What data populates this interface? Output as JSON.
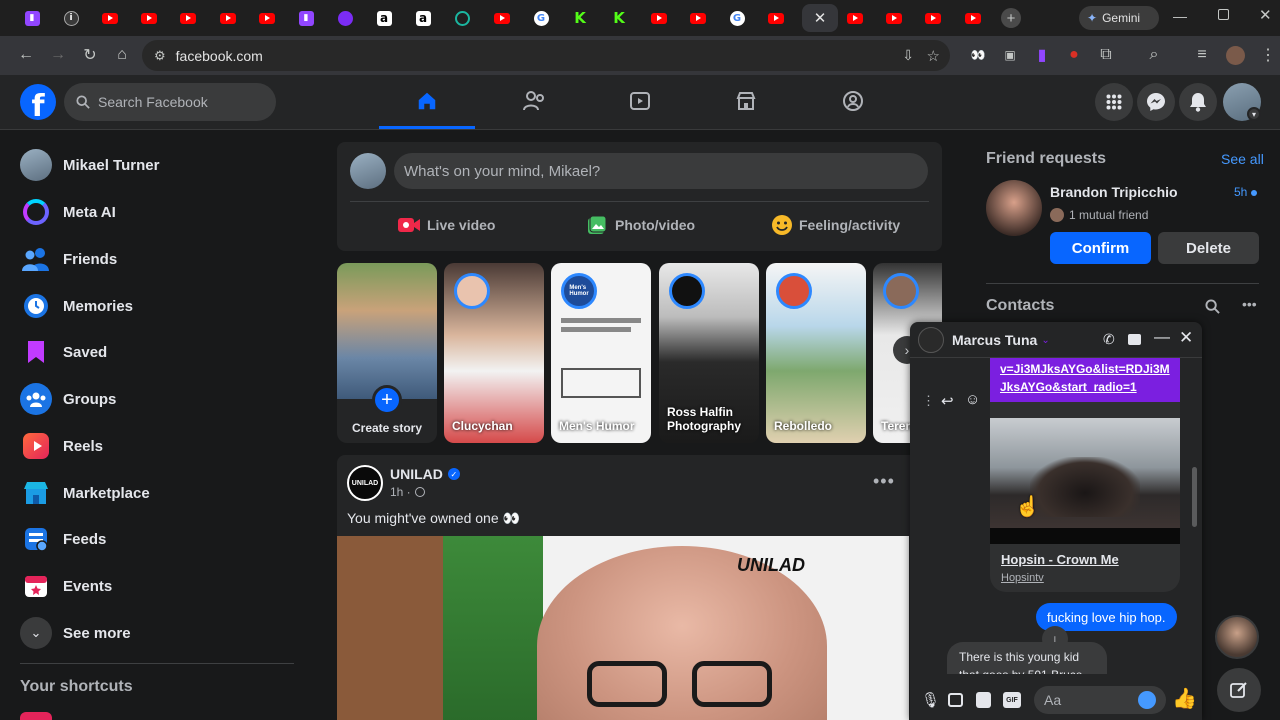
{
  "browser": {
    "gemini_label": "Gemini",
    "url": "facebook.com"
  },
  "fb": {
    "search_placeholder": "Search Facebook",
    "profile_name": "Mikael Turner",
    "sidebar": [
      {
        "label": "Mikael Turner",
        "icon": "avatar"
      },
      {
        "label": "Meta AI",
        "icon": "meta-ai-icon"
      },
      {
        "label": "Friends",
        "icon": "friends-icon"
      },
      {
        "label": "Memories",
        "icon": "memories-icon"
      },
      {
        "label": "Saved",
        "icon": "saved-icon"
      },
      {
        "label": "Groups",
        "icon": "groups-icon"
      },
      {
        "label": "Reels",
        "icon": "reels-icon"
      },
      {
        "label": "Marketplace",
        "icon": "marketplace-icon"
      },
      {
        "label": "Feeds",
        "icon": "feeds-icon"
      },
      {
        "label": "Events",
        "icon": "events-icon"
      },
      {
        "label": "See more",
        "icon": "chevron-down-icon"
      }
    ],
    "shortcuts_heading": "Your shortcuts",
    "composer": {
      "placeholder": "What's on your mind, Mikael?",
      "live": "Live video",
      "photo": "Photo/video",
      "feeling": "Feeling/activity"
    },
    "stories": [
      {
        "name": "Create story"
      },
      {
        "name": "Clucychan"
      },
      {
        "name": "Men's Humor"
      },
      {
        "name": "Ross Halfin Photography"
      },
      {
        "name": "Rebolledo"
      },
      {
        "name": "Teren"
      }
    ],
    "post": {
      "page": "UNILAD",
      "time": "1h ·",
      "text": "You might've owned one 👀",
      "watermark": "UNILAD"
    },
    "friend_requests": {
      "heading": "Friend requests",
      "see_all": "See all",
      "name": "Brandon Tripicchio",
      "time": "5h",
      "mutual": "1 mutual friend",
      "confirm": "Confirm",
      "delete": "Delete"
    },
    "contacts_heading": "Contacts",
    "chat": {
      "name": "Marcus Tuna",
      "link_text": "v=Ji3MJksAYGo&list=RDJi3MJksAYGo&start_radio=1",
      "video_title": "Hopsin - Crown Me",
      "video_channel": "Hopsintv",
      "sent_message": "fucking love hip hop.",
      "received_message": "There is this young kid that goes by 501 Bruce",
      "input_placeholder": "Aa"
    }
  },
  "colors": {
    "fb_blue": "#0866ff",
    "bg": "#18191a",
    "surface": "#242526",
    "chat_bubble_blue": "#0866ff",
    "link_purple": "#7b1fe0"
  }
}
